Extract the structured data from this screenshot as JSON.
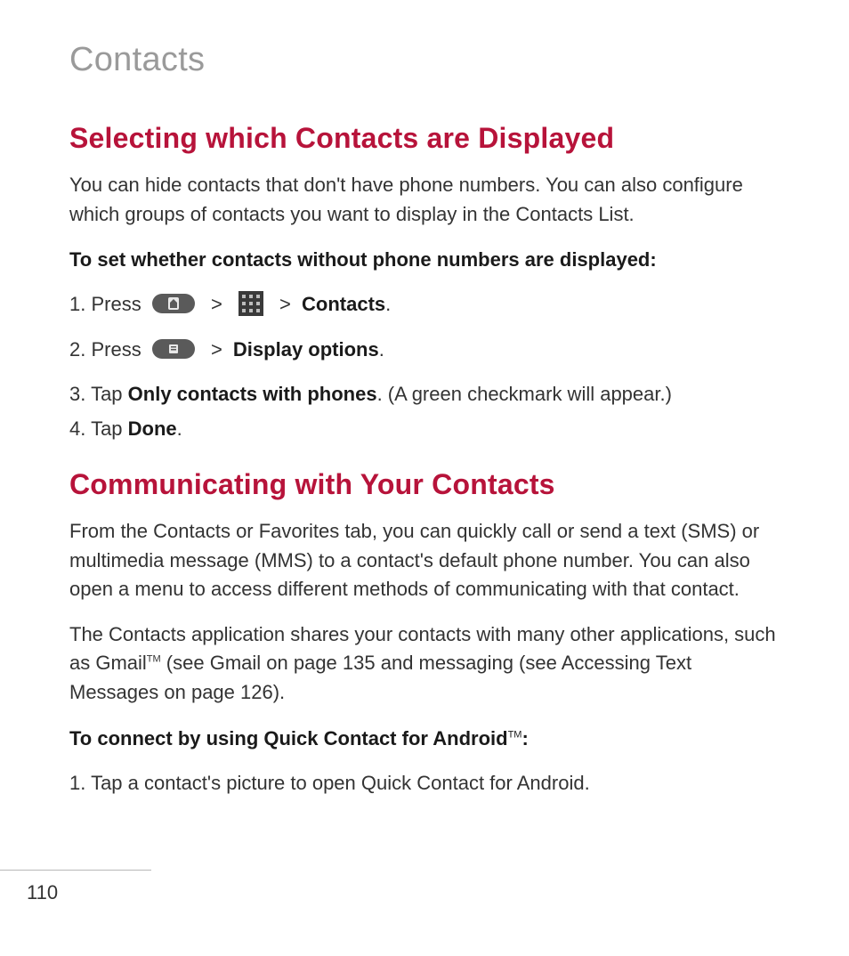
{
  "page": {
    "title": "Contacts",
    "number": "110"
  },
  "sections": [
    {
      "heading": "Selecting which Contacts are Displayed",
      "intro": "You can hide contacts that don't have phone numbers. You can also configure which groups of contacts you want to display in the Contacts List.",
      "subheading": "To set whether contacts without phone numbers are displayed:",
      "steps": {
        "s1_prefix": "1. Press ",
        "s1_gt": ">",
        "s1_contacts": "Contacts",
        "s1_dot": ".",
        "s2_prefix": "2. Press ",
        "s2_gt": ">",
        "s2_display": "Display options",
        "s2_dot": ".",
        "s3_prefix": "3. Tap ",
        "s3_bold": "Only contacts with phones",
        "s3_rest": ". (A green checkmark will appear.)",
        "s4_prefix": "4. Tap ",
        "s4_bold": "Done",
        "s4_dot": "."
      }
    },
    {
      "heading": "Communicating with Your Contacts",
      "para1": "From the Contacts or Favorites tab, you can quickly call or send a text (SMS) or multimedia message (MMS) to a contact's default phone number. You can also open a menu to access different methods of communicating with that contact.",
      "para2_a": "The Contacts application shares your contacts with many other applications, such as Gmail",
      "para2_tm": "TM",
      "para2_b": " (see Gmail on page 135 and messaging (see Accessing Text Messages on page 126).",
      "subheading_a": "To connect by using Quick Contact for Android",
      "subheading_tm": "TM",
      "subheading_b": ":",
      "step1": "1. Tap a contact's picture to open Quick Contact for Android."
    }
  ]
}
